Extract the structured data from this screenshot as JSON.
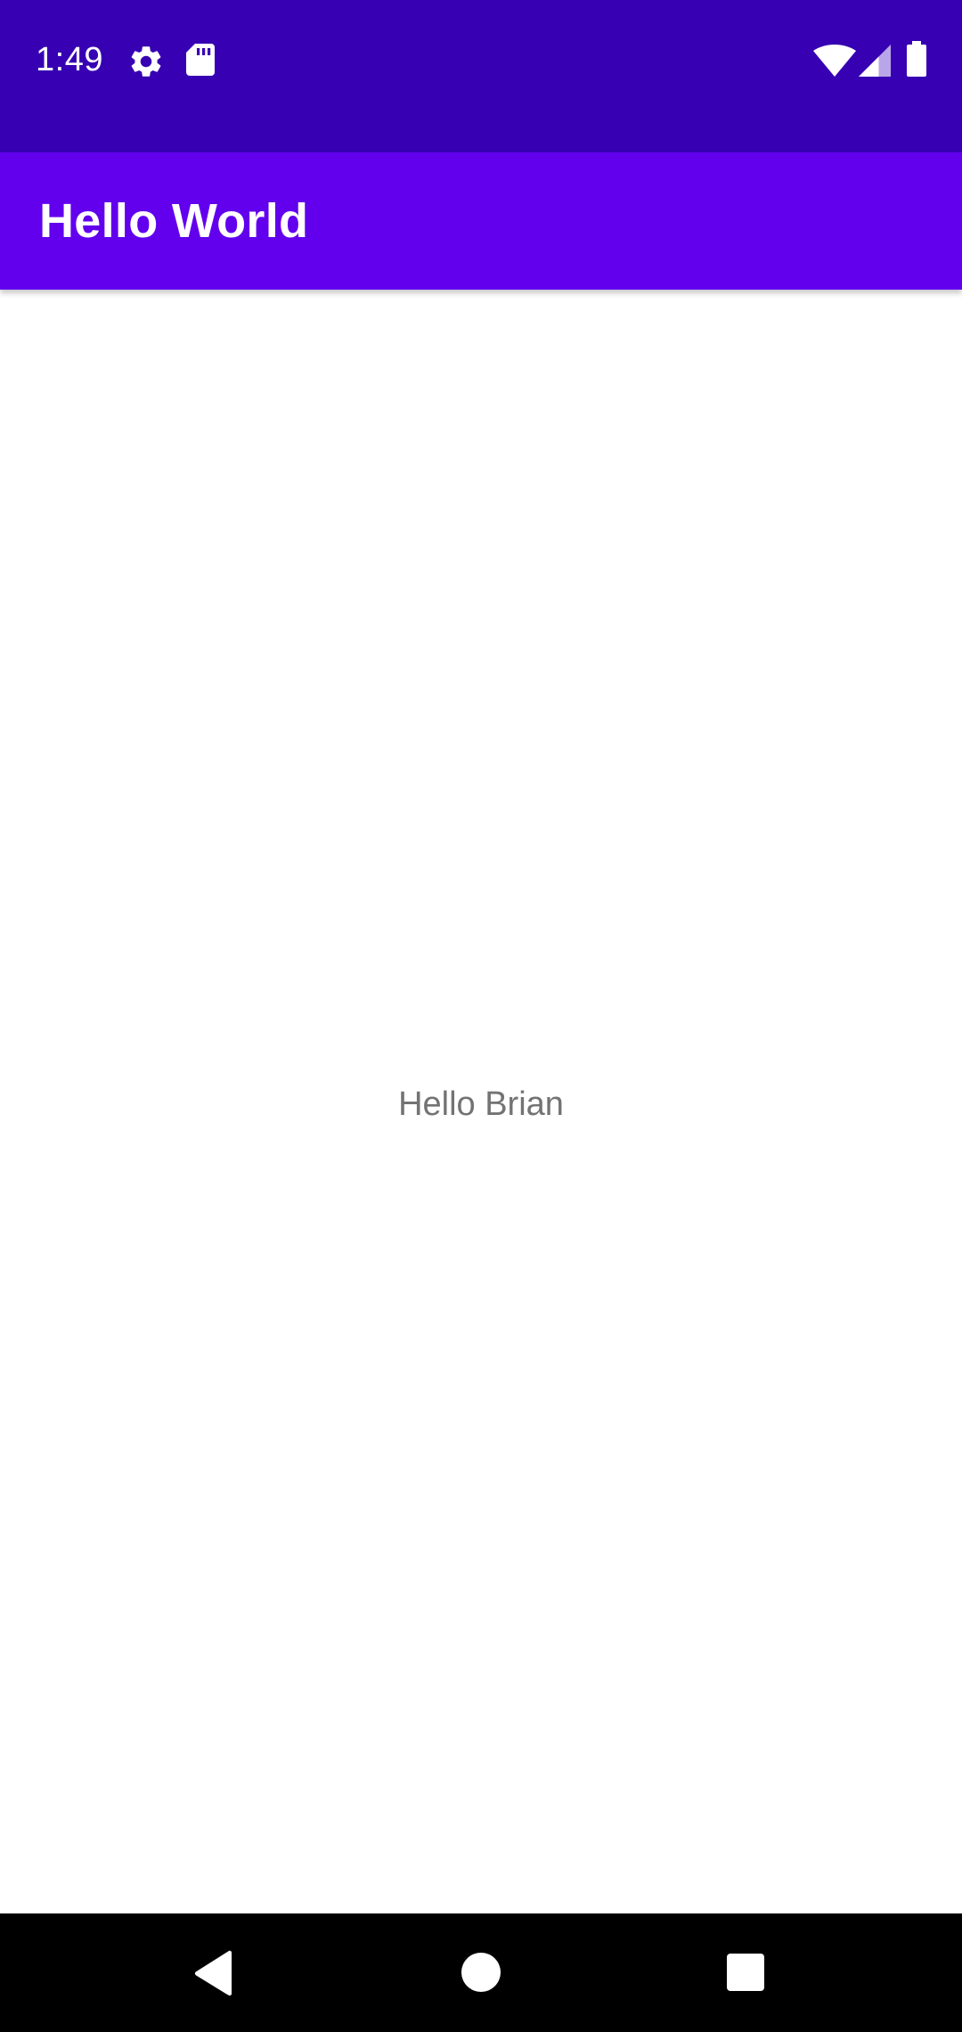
{
  "status_bar": {
    "time": "1:49",
    "background_color": "#3700b3",
    "icons": [
      "settings-icon",
      "sd-card-icon",
      "wifi-icon",
      "cell-signal-icon",
      "battery-icon"
    ]
  },
  "app_bar": {
    "title": "Hello World",
    "background_color": "#6200ee"
  },
  "main": {
    "message": "Hello Brian",
    "text_color": "#737373"
  },
  "navigation_bar": {
    "background_color": "#000000",
    "buttons": [
      "back-icon",
      "home-icon",
      "recents-icon"
    ]
  }
}
